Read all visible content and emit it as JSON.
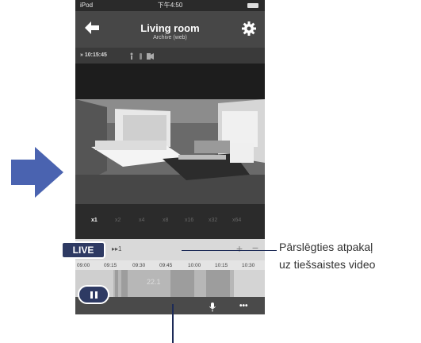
{
  "colors": {
    "arrow": "#4a63b0",
    "highlight": "#2e3a63",
    "navbar": "#474747",
    "callout_line": "#1d2b57"
  },
  "status_bar": {
    "carrier": "iPod",
    "time": "下午4:50"
  },
  "nav": {
    "title": "Living room",
    "subtitle": "Archive (web)",
    "back_icon": "back-arrow-icon",
    "settings_icon": "gear-icon"
  },
  "info": {
    "time": "» 10:15:45"
  },
  "speeds": [
    "x1",
    "x2",
    "x4",
    "x8",
    "x16",
    "x32",
    "x64"
  ],
  "controls": {
    "skip_label": "▸▸1",
    "live_label": "LIVE",
    "plus": "+",
    "minus": "−"
  },
  "timeline": {
    "ticks": [
      "09:00",
      "09:15",
      "09:30",
      "09:45",
      "10:00",
      "10:15",
      "10:30"
    ],
    "date": "22.1"
  },
  "bottom": {
    "more": "•••"
  },
  "callout": {
    "line1": "Pārslēgties atpakaļ",
    "line2": "uz tiešsaistes video"
  }
}
